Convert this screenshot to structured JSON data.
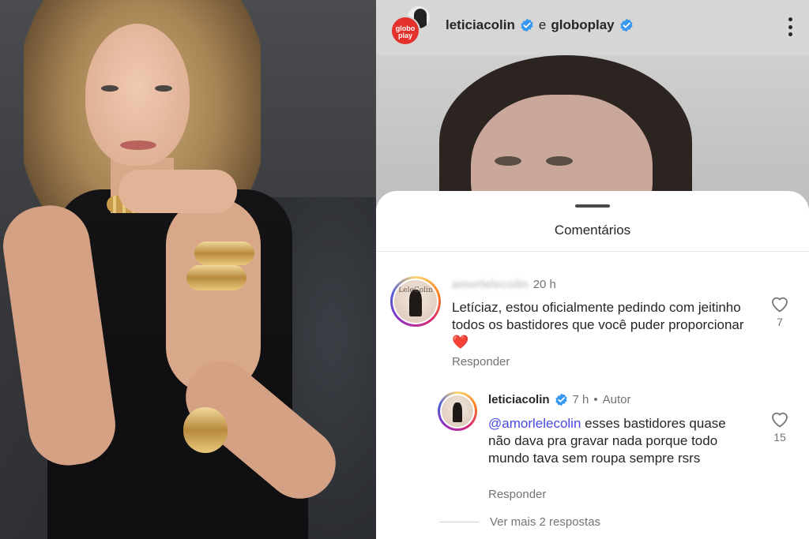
{
  "header": {
    "username_1": "leticiacolin",
    "conjunction": "e",
    "username_2": "globoplay",
    "globoplay_avatar_text": "globo play"
  },
  "sheet": {
    "title": "Comentários"
  },
  "comments": [
    {
      "username": "amorlelecolin",
      "time": "20 h",
      "avatar_text": "LeleColin",
      "text": "Letíciaz, estou oficialmente pedindo com jeitinho todos os bastidores que você puder proporcionar ❤️",
      "reply_label": "Responder",
      "likes": "7"
    }
  ],
  "replies": [
    {
      "username": "leticiacolin",
      "time": "7 h",
      "separator": "•",
      "author_label": "Autor",
      "mention": "@amorlelecolin",
      "text": " esses bastidores quase não dava pra gravar nada porque todo mundo tava sem roupa sempre rsrs",
      "reply_label": "Responder",
      "likes": "15"
    }
  ],
  "more_replies": "Ver mais 2 respostas",
  "colors": {
    "verified": "#3897f0",
    "mention": "#4a4ae0",
    "globoplay_red": "#e5312b",
    "heart_red": "#e0262f"
  }
}
